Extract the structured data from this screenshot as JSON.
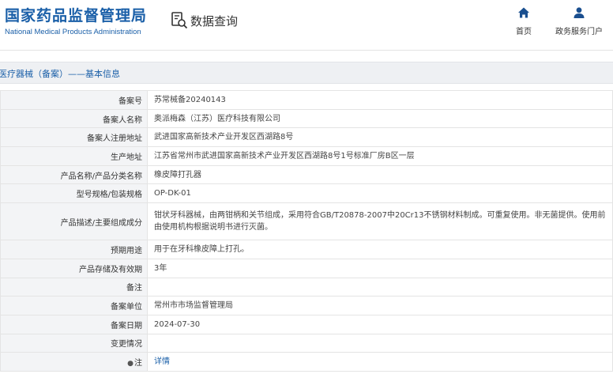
{
  "header": {
    "logo_cn": "国家药品监督管理局",
    "logo_en": "National Medical Products Administration",
    "page_tag": "数据查询",
    "nav": [
      {
        "label": "首页",
        "icon": "home-icon"
      },
      {
        "label": "政务服务门户",
        "icon": "user-icon"
      }
    ]
  },
  "breadcrumb": "医疗器械（备案）——基本信息",
  "record": {
    "rows": [
      {
        "label": "备案号",
        "value": "苏常械备20240143"
      },
      {
        "label": "备案人名称",
        "value": "奥派梅森（江苏）医疗科技有限公司"
      },
      {
        "label": "备案人注册地址",
        "value": "武进国家高新技术产业开发区西湖路8号"
      },
      {
        "label": "生产地址",
        "value": "江苏省常州市武进国家高新技术产业开发区西湖路8号1号标准厂房B区一层"
      },
      {
        "label": "产品名称/产品分类名称",
        "value": "橡皮障打孔器"
      },
      {
        "label": "型号规格/包装规格",
        "value": "OP-DK-01"
      },
      {
        "label": "产品描述/主要组成成分",
        "value": "钳状牙科器械，由两钳柄和关节组成，采用符合GB/T20878-2007中20Cr13不锈钢材料制成。可重复使用。非无菌提供。使用前由使用机构根据说明书进行灭菌。"
      },
      {
        "label": "预期用途",
        "value": "用于在牙科橡皮障上打孔。"
      },
      {
        "label": "产品存储及有效期",
        "value": "3年"
      },
      {
        "label": "备注",
        "value": ""
      },
      {
        "label": "备案单位",
        "value": "常州市市场监督管理局"
      },
      {
        "label": "备案日期",
        "value": "2024-07-30"
      },
      {
        "label": "变更情况",
        "value": ""
      }
    ],
    "note_label": "注",
    "note_link": "详情"
  }
}
